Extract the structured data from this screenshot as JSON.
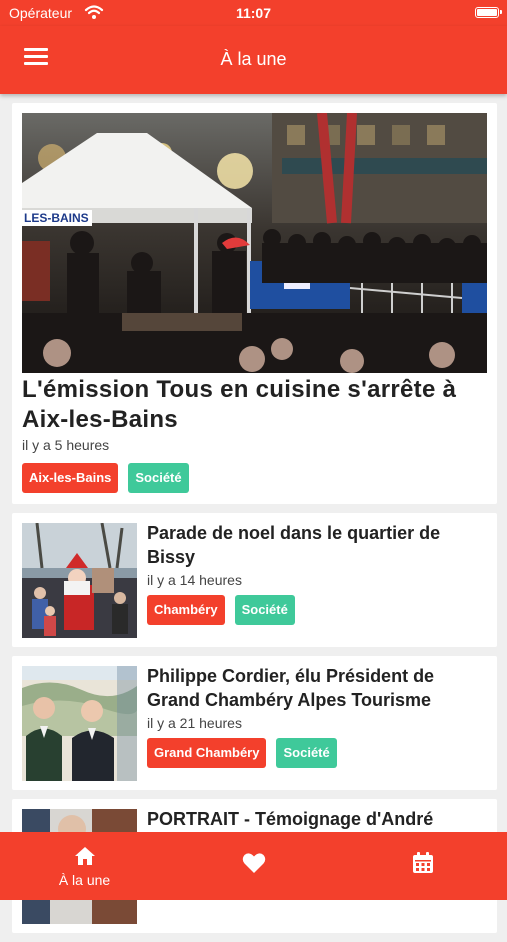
{
  "status_bar": {
    "carrier": "Opérateur",
    "time": "11:07"
  },
  "header": {
    "title": "À la une"
  },
  "articles": [
    {
      "headline": "L'émission Tous en cuisine s'arrête à Aix-les-Bains",
      "time_ago": "il y a 5 heures",
      "tags": [
        "Aix-les-Bains",
        "Société"
      ],
      "image_text": "LES-BAINS"
    },
    {
      "headline": "Parade de noel dans le quartier de Bissy",
      "time_ago": "il y a 14 heures",
      "tags": [
        "Chambéry",
        "Société"
      ]
    },
    {
      "headline": "Philippe Cordier, élu Président de Grand Chambéry Alpes Tourisme",
      "time_ago": "il y a 21 heures",
      "tags": [
        "Grand Chambéry",
        "Société"
      ]
    },
    {
      "headline": "PORTRAIT - Témoignage d'André"
    }
  ],
  "tab_bar": {
    "tabs": [
      {
        "label": "À la une",
        "icon": "home-icon"
      },
      {
        "label": "",
        "icon": "heart-icon"
      },
      {
        "label": "",
        "icon": "calendar-icon"
      }
    ]
  },
  "colors": {
    "brand": "#f3402c",
    "tag_location": "#f3402c",
    "tag_category": "#3fc99a"
  }
}
